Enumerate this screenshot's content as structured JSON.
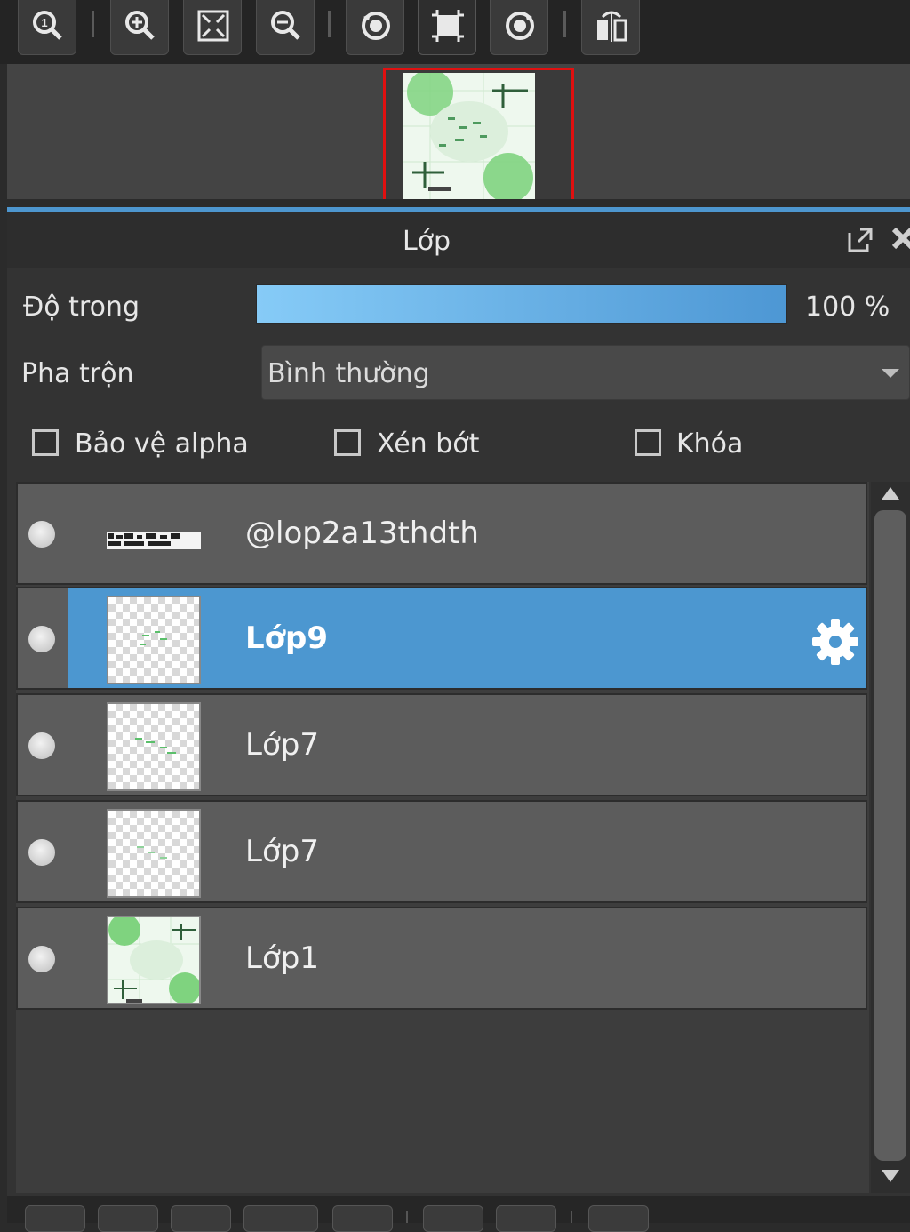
{
  "navigator": {
    "toolbar": [
      {
        "name": "zoom-actual-size-button",
        "icon": "magnifier-one-icon"
      },
      {
        "name": "zoom-in-button",
        "icon": "zoom-in-icon"
      },
      {
        "name": "fit-to-window-button",
        "icon": "fit-window-icon"
      },
      {
        "name": "zoom-out-button",
        "icon": "zoom-out-icon"
      },
      {
        "name": "rotate-left-button",
        "icon": "rotate-left-icon"
      },
      {
        "name": "reset-view-button",
        "icon": "frame-icon"
      },
      {
        "name": "rotate-right-button",
        "icon": "rotate-right-icon"
      },
      {
        "name": "flip-horizontal-button",
        "icon": "flip-icon"
      }
    ]
  },
  "layers_panel": {
    "title": "Lớp",
    "opacity_label": "Độ trong",
    "opacity_percent": 100,
    "opacity_value": "100 %",
    "blend_label": "Pha trộn",
    "blend_value": "Bình thường",
    "checkboxes": [
      {
        "label": "Bảo vệ alpha",
        "checked": false
      },
      {
        "label": "Xén bớt",
        "checked": false
      },
      {
        "label": "Khóa",
        "checked": false
      }
    ],
    "layers": [
      {
        "name": "@lop2a13thdth",
        "visible": true,
        "selected": false,
        "thumb": "text"
      },
      {
        "name": "Lớp9",
        "visible": true,
        "selected": true,
        "thumb": "sparse"
      },
      {
        "name": "Lớp7",
        "visible": true,
        "selected": false,
        "thumb": "sparse"
      },
      {
        "name": "Lớp7",
        "visible": true,
        "selected": false,
        "thumb": "sparse"
      },
      {
        "name": "Lớp1",
        "visible": true,
        "selected": false,
        "thumb": "full"
      }
    ]
  },
  "colors": {
    "selection": "#4c97d0",
    "accent_line": "#4d96cf",
    "navigator_frame": "#e01010",
    "thumb_green": "#6ccd6c"
  }
}
